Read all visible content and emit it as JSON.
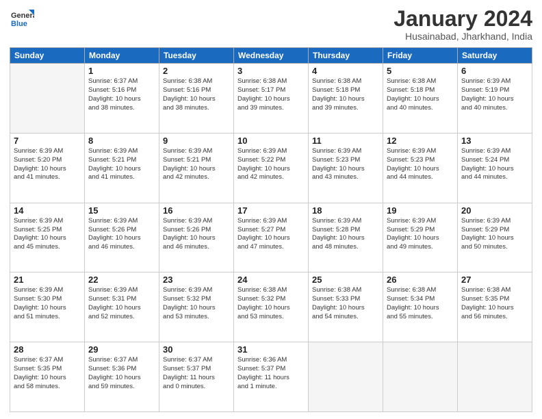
{
  "header": {
    "logo_general": "General",
    "logo_blue": "Blue",
    "title": "January 2024",
    "location": "Husainabad, Jharkhand, India"
  },
  "days_of_week": [
    "Sunday",
    "Monday",
    "Tuesday",
    "Wednesday",
    "Thursday",
    "Friday",
    "Saturday"
  ],
  "weeks": [
    [
      {
        "day": "",
        "info": ""
      },
      {
        "day": "1",
        "info": "Sunrise: 6:37 AM\nSunset: 5:16 PM\nDaylight: 10 hours\nand 38 minutes."
      },
      {
        "day": "2",
        "info": "Sunrise: 6:38 AM\nSunset: 5:16 PM\nDaylight: 10 hours\nand 38 minutes."
      },
      {
        "day": "3",
        "info": "Sunrise: 6:38 AM\nSunset: 5:17 PM\nDaylight: 10 hours\nand 39 minutes."
      },
      {
        "day": "4",
        "info": "Sunrise: 6:38 AM\nSunset: 5:18 PM\nDaylight: 10 hours\nand 39 minutes."
      },
      {
        "day": "5",
        "info": "Sunrise: 6:38 AM\nSunset: 5:18 PM\nDaylight: 10 hours\nand 40 minutes."
      },
      {
        "day": "6",
        "info": "Sunrise: 6:39 AM\nSunset: 5:19 PM\nDaylight: 10 hours\nand 40 minutes."
      }
    ],
    [
      {
        "day": "7",
        "info": "Sunrise: 6:39 AM\nSunset: 5:20 PM\nDaylight: 10 hours\nand 41 minutes."
      },
      {
        "day": "8",
        "info": "Sunrise: 6:39 AM\nSunset: 5:21 PM\nDaylight: 10 hours\nand 41 minutes."
      },
      {
        "day": "9",
        "info": "Sunrise: 6:39 AM\nSunset: 5:21 PM\nDaylight: 10 hours\nand 42 minutes."
      },
      {
        "day": "10",
        "info": "Sunrise: 6:39 AM\nSunset: 5:22 PM\nDaylight: 10 hours\nand 42 minutes."
      },
      {
        "day": "11",
        "info": "Sunrise: 6:39 AM\nSunset: 5:23 PM\nDaylight: 10 hours\nand 43 minutes."
      },
      {
        "day": "12",
        "info": "Sunrise: 6:39 AM\nSunset: 5:23 PM\nDaylight: 10 hours\nand 44 minutes."
      },
      {
        "day": "13",
        "info": "Sunrise: 6:39 AM\nSunset: 5:24 PM\nDaylight: 10 hours\nand 44 minutes."
      }
    ],
    [
      {
        "day": "14",
        "info": "Sunrise: 6:39 AM\nSunset: 5:25 PM\nDaylight: 10 hours\nand 45 minutes."
      },
      {
        "day": "15",
        "info": "Sunrise: 6:39 AM\nSunset: 5:26 PM\nDaylight: 10 hours\nand 46 minutes."
      },
      {
        "day": "16",
        "info": "Sunrise: 6:39 AM\nSunset: 5:26 PM\nDaylight: 10 hours\nand 46 minutes."
      },
      {
        "day": "17",
        "info": "Sunrise: 6:39 AM\nSunset: 5:27 PM\nDaylight: 10 hours\nand 47 minutes."
      },
      {
        "day": "18",
        "info": "Sunrise: 6:39 AM\nSunset: 5:28 PM\nDaylight: 10 hours\nand 48 minutes."
      },
      {
        "day": "19",
        "info": "Sunrise: 6:39 AM\nSunset: 5:29 PM\nDaylight: 10 hours\nand 49 minutes."
      },
      {
        "day": "20",
        "info": "Sunrise: 6:39 AM\nSunset: 5:29 PM\nDaylight: 10 hours\nand 50 minutes."
      }
    ],
    [
      {
        "day": "21",
        "info": "Sunrise: 6:39 AM\nSunset: 5:30 PM\nDaylight: 10 hours\nand 51 minutes."
      },
      {
        "day": "22",
        "info": "Sunrise: 6:39 AM\nSunset: 5:31 PM\nDaylight: 10 hours\nand 52 minutes."
      },
      {
        "day": "23",
        "info": "Sunrise: 6:39 AM\nSunset: 5:32 PM\nDaylight: 10 hours\nand 53 minutes."
      },
      {
        "day": "24",
        "info": "Sunrise: 6:38 AM\nSunset: 5:32 PM\nDaylight: 10 hours\nand 53 minutes."
      },
      {
        "day": "25",
        "info": "Sunrise: 6:38 AM\nSunset: 5:33 PM\nDaylight: 10 hours\nand 54 minutes."
      },
      {
        "day": "26",
        "info": "Sunrise: 6:38 AM\nSunset: 5:34 PM\nDaylight: 10 hours\nand 55 minutes."
      },
      {
        "day": "27",
        "info": "Sunrise: 6:38 AM\nSunset: 5:35 PM\nDaylight: 10 hours\nand 56 minutes."
      }
    ],
    [
      {
        "day": "28",
        "info": "Sunrise: 6:37 AM\nSunset: 5:35 PM\nDaylight: 10 hours\nand 58 minutes."
      },
      {
        "day": "29",
        "info": "Sunrise: 6:37 AM\nSunset: 5:36 PM\nDaylight: 10 hours\nand 59 minutes."
      },
      {
        "day": "30",
        "info": "Sunrise: 6:37 AM\nSunset: 5:37 PM\nDaylight: 11 hours\nand 0 minutes."
      },
      {
        "day": "31",
        "info": "Sunrise: 6:36 AM\nSunset: 5:37 PM\nDaylight: 11 hours\nand 1 minute."
      },
      {
        "day": "",
        "info": ""
      },
      {
        "day": "",
        "info": ""
      },
      {
        "day": "",
        "info": ""
      }
    ]
  ]
}
